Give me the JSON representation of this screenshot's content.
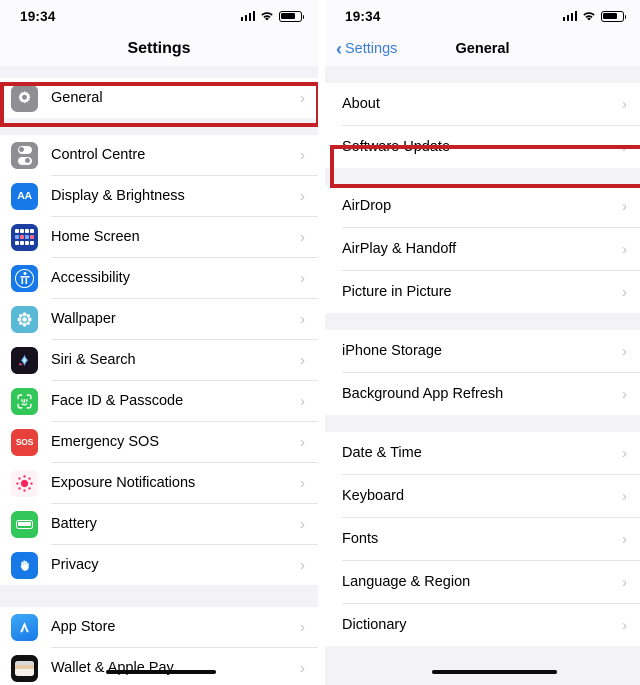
{
  "status_bar": {
    "time": "19:34",
    "icons": [
      "cellular-signal-icon",
      "wifi-icon",
      "battery-icon"
    ]
  },
  "highlight_color": "#c32026",
  "accent_color": "#3b7dd8",
  "left_screen": {
    "nav": {
      "title": "Settings"
    },
    "groups": [
      {
        "rows": [
          {
            "label": "General",
            "icon": "gear-icon",
            "highlighted": true
          }
        ]
      },
      {
        "rows": [
          {
            "label": "Control Centre",
            "icon": "control-centre-icon"
          },
          {
            "label": "Display & Brightness",
            "icon": "display-brightness-icon"
          },
          {
            "label": "Home Screen",
            "icon": "home-screen-icon"
          },
          {
            "label": "Accessibility",
            "icon": "accessibility-icon"
          },
          {
            "label": "Wallpaper",
            "icon": "wallpaper-icon"
          },
          {
            "label": "Siri & Search",
            "icon": "siri-icon"
          },
          {
            "label": "Face ID & Passcode",
            "icon": "face-id-icon"
          },
          {
            "label": "Emergency SOS",
            "icon": "emergency-sos-icon"
          },
          {
            "label": "Exposure Notifications",
            "icon": "exposure-notifications-icon"
          },
          {
            "label": "Battery",
            "icon": "battery-settings-icon"
          },
          {
            "label": "Privacy",
            "icon": "privacy-hand-icon"
          }
        ]
      },
      {
        "rows": [
          {
            "label": "App Store",
            "icon": "app-store-icon"
          },
          {
            "label": "Wallet & Apple Pay",
            "icon": "wallet-icon"
          }
        ]
      }
    ]
  },
  "right_screen": {
    "nav": {
      "back_label": "Settings",
      "title": "General"
    },
    "groups": [
      {
        "rows": [
          {
            "label": "About"
          },
          {
            "label": "Software Update",
            "highlighted": true
          }
        ]
      },
      {
        "rows": [
          {
            "label": "AirDrop"
          },
          {
            "label": "AirPlay & Handoff"
          },
          {
            "label": "Picture in Picture"
          }
        ]
      },
      {
        "rows": [
          {
            "label": "iPhone Storage"
          },
          {
            "label": "Background App Refresh"
          }
        ]
      },
      {
        "rows": [
          {
            "label": "Date & Time"
          },
          {
            "label": "Keyboard"
          },
          {
            "label": "Fonts"
          },
          {
            "label": "Language & Region"
          },
          {
            "label": "Dictionary"
          }
        ]
      }
    ]
  }
}
